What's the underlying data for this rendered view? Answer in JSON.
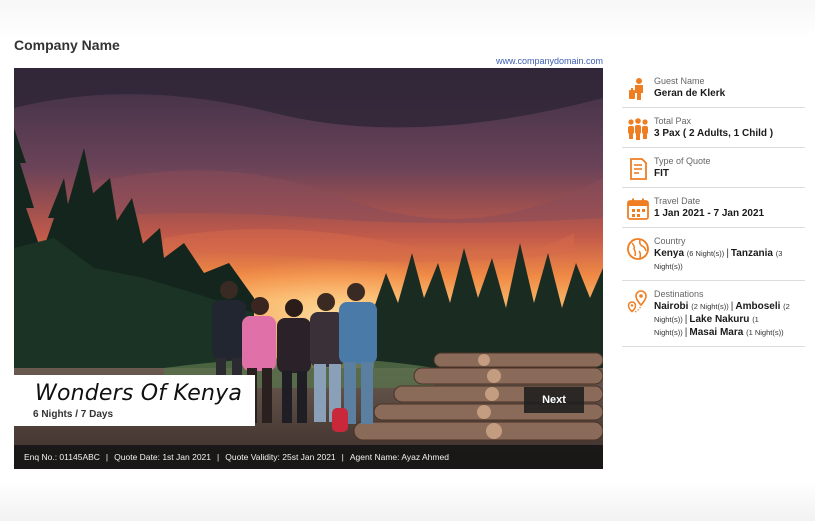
{
  "header": {
    "company_name": "Company Name",
    "domain": "www.companydomain.com"
  },
  "hero": {
    "title": "Wonders Of Kenya",
    "duration": "6 Nights / 7 Days",
    "next_label": "Next"
  },
  "footer": {
    "enquiry": "Enq No.: 01145ABC",
    "quote_date": "Quote Date: 1st Jan 2021",
    "quote_validity": "Quote Validity: 25st Jan 2021",
    "agent": "Agent Name: Ayaz Ahmed",
    "separator": "|"
  },
  "details": {
    "guest": {
      "label": "Guest Name",
      "value": "Geran de Klerk",
      "icon": "guest-person-icon"
    },
    "pax": {
      "label": "Total Pax",
      "value": "3 Pax ( 2 Adults, 1 Child )",
      "icon": "group-people-icon"
    },
    "quote_type": {
      "label": "Type of Quote",
      "value": "FIT",
      "icon": "document-icon"
    },
    "travel_date": {
      "label": "Travel Date",
      "value": "1 Jan 2021 - 7 Jan 2021",
      "icon": "calendar-icon"
    },
    "country": {
      "label": "Country",
      "icon": "globe-icon",
      "items": [
        {
          "name": "Kenya",
          "nights": "(6 Night(s))"
        },
        {
          "name": "Tanzania",
          "nights": "(3 Night(s))"
        }
      ]
    },
    "destinations": {
      "label": "Destinations",
      "icon": "map-pin-icon",
      "items": [
        {
          "name": "Nairobi",
          "nights": "(2 Night(s))"
        },
        {
          "name": "Amboseli",
          "nights": "(2 Night(s))"
        },
        {
          "name": "Lake Nakuru",
          "nights": "(1 Night(s))"
        },
        {
          "name": "Masai Mara",
          "nights": "(1 Night(s))"
        }
      ]
    }
  },
  "colors": {
    "accent": "#ef7d22",
    "link": "#3c5db0",
    "footer_bg": "#141414"
  }
}
